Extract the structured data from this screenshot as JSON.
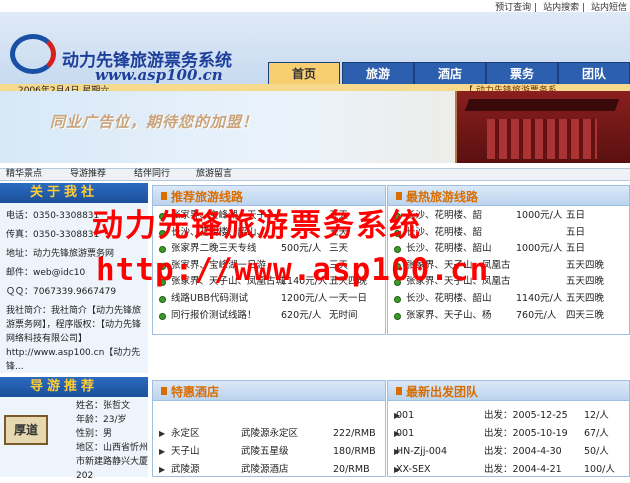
{
  "top_links": [
    "预订查询",
    "站内搜索",
    "站内短信"
  ],
  "site": {
    "title": "动力先锋旅游票务系统",
    "url": "www.asp100.cn"
  },
  "nav": {
    "tabs": [
      "首页",
      "旅游",
      "酒店",
      "票务",
      "团队"
    ]
  },
  "date_bar": {
    "date": "2006年2月4日 星期六",
    "marquee": "【 动力先锋旅游票务系"
  },
  "banner": {
    "text": "同业广告位，期待您的加盟！"
  },
  "subnav": [
    "精华景点",
    "导游推荐",
    "结伴同行",
    "旅游留言"
  ],
  "about": {
    "title": "关于我社",
    "rows": [
      {
        "label": "电话：",
        "value": "0350-3308831"
      },
      {
        "label": "传真：",
        "value": "0350-3308831"
      },
      {
        "label": "地址：",
        "value": "动力先锋旅游票务网"
      },
      {
        "label": "邮件：",
        "value": "web@idc10"
      },
      {
        "label": "ＱＱ：",
        "value": "7067339.9667479"
      }
    ],
    "intro": "我社简介：我社简介【动力先锋旅游票务网】，程序版权：【动力先锋网络科技有限公司】http://www.asp100.cn【动力先锋..."
  },
  "guide": {
    "title": "导游推荐",
    "sign": "厚道",
    "info": [
      "姓名：张哲文",
      "年龄：23/岁",
      "性别：男",
      "地区：山西省忻州市新建路静兴大厦202"
    ]
  },
  "recommended": {
    "title": "推荐旅游线路",
    "rows": [
      [
        "张家界、宝峰湖、天子",
        "",
        "五天"
      ],
      [
        "长沙、花明楼、韶山、",
        "",
        "五天"
      ],
      [
        "张家界二晚三天专线",
        "500元/人",
        "三天"
      ],
      [
        "张家界、宝峰湖一日游",
        "",
        "三天"
      ],
      [
        "张家界、天子山、凤凰古城",
        "1140元/人",
        "五天四晚"
      ],
      [
        "线路UBB代码测试",
        "1200元/人",
        "一天一日"
      ],
      [
        "同行报价测试线路！",
        "620元/人",
        "无时间"
      ]
    ]
  },
  "hot": {
    "title": "最热旅游线路",
    "rows": [
      [
        "长沙、花明楼、韶",
        "1000元/人",
        "五日"
      ],
      [
        "长沙、花明楼、韶",
        "",
        "五日"
      ],
      [
        "长沙、花明楼、韶山",
        "1000元/人",
        "五日"
      ],
      [
        "张家界、天子山、凤凰古",
        "",
        "五天四晚"
      ],
      [
        "张家界、天子山、凤凰古",
        "",
        "五天四晚"
      ],
      [
        "长沙、花明楼、韶山",
        "1140元/人",
        "五天四晚"
      ],
      [
        "张家界、天子山、杨",
        "760元/人",
        "四天三晚"
      ]
    ]
  },
  "hotels": {
    "title": "特惠酒店",
    "rows": [
      [
        "永定区",
        "武陵源永定区",
        "222/RMB"
      ],
      [
        "天子山",
        "武陵五星级",
        "180/RMB"
      ],
      [
        "武陵源",
        "武陵源酒店",
        "20/RMB"
      ]
    ]
  },
  "departures": {
    "title": "最新出发团队",
    "rows": [
      [
        "001",
        "出发：2005-12-25",
        "12/人"
      ],
      [
        "001",
        "出发：2005-10-19",
        "67/人"
      ],
      [
        "HN-Zjj-004",
        "出发：2004-4-30",
        "50/人"
      ],
      [
        "XX-SEX",
        "出发：2004-4-21",
        "100/人"
      ]
    ]
  },
  "watermark": {
    "line1": "动力先锋旅游票务系统",
    "line2": "http://www.asp100.cn"
  }
}
